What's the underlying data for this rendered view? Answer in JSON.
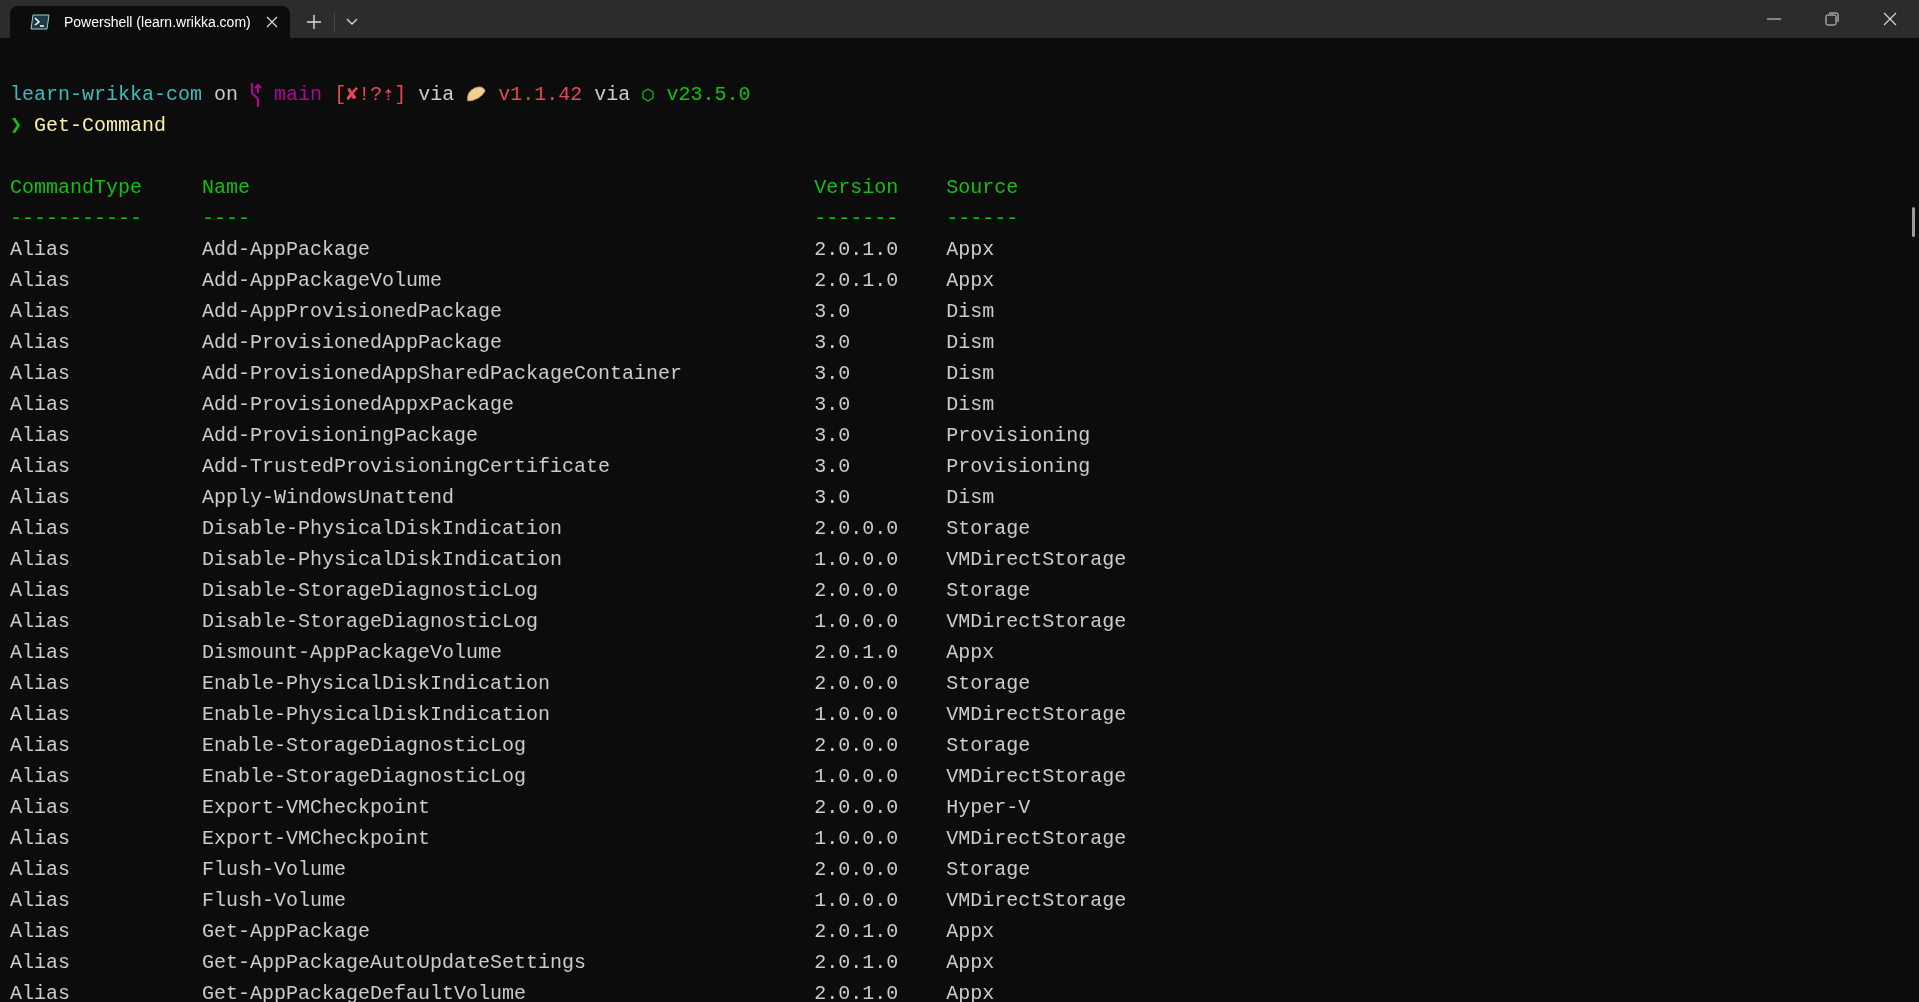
{
  "tab": {
    "title": "Powershell (learn.wrikka.com)",
    "selected": true
  },
  "prompt": {
    "directory": "learn-wrikka-com",
    "on": "on",
    "branch": "main",
    "git_status_open": "[",
    "git_status_x": "✘",
    "git_status_rest": "!?⇡]",
    "via_1": "via",
    "bun_version": "v1.1.42",
    "via_2": "via",
    "node_version": "v23.5.0",
    "symbol": "❯",
    "command": "Get-Command"
  },
  "table": {
    "columns": [
      {
        "label": "CommandType",
        "rule": "-----------"
      },
      {
        "label": "Name",
        "rule": "----"
      },
      {
        "label": "Version",
        "rule": "-------"
      },
      {
        "label": "Source",
        "rule": "------"
      }
    ],
    "rows": [
      [
        "Alias",
        "Add-AppPackage",
        "2.0.1.0",
        "Appx"
      ],
      [
        "Alias",
        "Add-AppPackageVolume",
        "2.0.1.0",
        "Appx"
      ],
      [
        "Alias",
        "Add-AppProvisionedPackage",
        "3.0",
        "Dism"
      ],
      [
        "Alias",
        "Add-ProvisionedAppPackage",
        "3.0",
        "Dism"
      ],
      [
        "Alias",
        "Add-ProvisionedAppSharedPackageContainer",
        "3.0",
        "Dism"
      ],
      [
        "Alias",
        "Add-ProvisionedAppxPackage",
        "3.0",
        "Dism"
      ],
      [
        "Alias",
        "Add-ProvisioningPackage",
        "3.0",
        "Provisioning"
      ],
      [
        "Alias",
        "Add-TrustedProvisioningCertificate",
        "3.0",
        "Provisioning"
      ],
      [
        "Alias",
        "Apply-WindowsUnattend",
        "3.0",
        "Dism"
      ],
      [
        "Alias",
        "Disable-PhysicalDiskIndication",
        "2.0.0.0",
        "Storage"
      ],
      [
        "Alias",
        "Disable-PhysicalDiskIndication",
        "1.0.0.0",
        "VMDirectStorage"
      ],
      [
        "Alias",
        "Disable-StorageDiagnosticLog",
        "2.0.0.0",
        "Storage"
      ],
      [
        "Alias",
        "Disable-StorageDiagnosticLog",
        "1.0.0.0",
        "VMDirectStorage"
      ],
      [
        "Alias",
        "Dismount-AppPackageVolume",
        "2.0.1.0",
        "Appx"
      ],
      [
        "Alias",
        "Enable-PhysicalDiskIndication",
        "2.0.0.0",
        "Storage"
      ],
      [
        "Alias",
        "Enable-PhysicalDiskIndication",
        "1.0.0.0",
        "VMDirectStorage"
      ],
      [
        "Alias",
        "Enable-StorageDiagnosticLog",
        "2.0.0.0",
        "Storage"
      ],
      [
        "Alias",
        "Enable-StorageDiagnosticLog",
        "1.0.0.0",
        "VMDirectStorage"
      ],
      [
        "Alias",
        "Export-VMCheckpoint",
        "2.0.0.0",
        "Hyper-V"
      ],
      [
        "Alias",
        "Export-VMCheckpoint",
        "1.0.0.0",
        "VMDirectStorage"
      ],
      [
        "Alias",
        "Flush-Volume",
        "2.0.0.0",
        "Storage"
      ],
      [
        "Alias",
        "Flush-Volume",
        "1.0.0.0",
        "VMDirectStorage"
      ],
      [
        "Alias",
        "Get-AppPackage",
        "2.0.1.0",
        "Appx"
      ],
      [
        "Alias",
        "Get-AppPackageAutoUpdateSettings",
        "2.0.1.0",
        "Appx"
      ],
      [
        "Alias",
        "Get-AppPackageDefaultVolume",
        "2.0.1.0",
        "Appx"
      ]
    ]
  }
}
